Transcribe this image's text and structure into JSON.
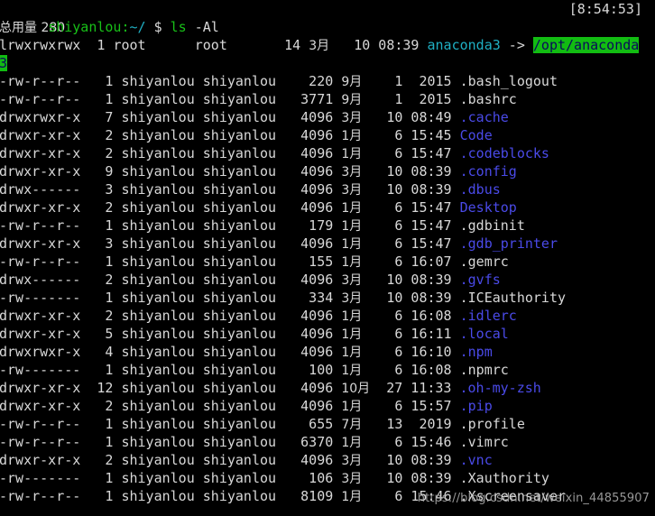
{
  "terminal": {
    "background_color": "#000000",
    "foreground_color": "#d8d8d8",
    "dir_color": "#4a4ae8",
    "symlink_color": "#1fb0c4",
    "prompt_color": "#18c018",
    "highlight_bg": "#12bc12"
  },
  "prompt": {
    "user_host": "shiyanlou:",
    "path": "~/",
    "sigil": "$",
    "command_name": "ls",
    "command_args": "-Al",
    "clock": "[8:54:53]"
  },
  "total_line": "总用量 280",
  "symlink_row": {
    "perms": "lrwxrwxrwx",
    "links": "1",
    "owner": "root",
    "group": "root",
    "size": "14",
    "month": "3月",
    "day": "10",
    "time": "08:39",
    "name": "anaconda3",
    "arrow": "->",
    "target_head": "/opt/anaconda",
    "target_wrap": "3"
  },
  "columns": [
    "perms",
    "links",
    "owner",
    "group",
    "size",
    "month",
    "day",
    "time",
    "name"
  ],
  "rows": [
    {
      "perms": "-rw-r--r--",
      "links": "1",
      "owner": "shiyanlou",
      "group": "shiyanlou",
      "size": "220",
      "month": "9月",
      "day": "1",
      "time": "2015",
      "name": ".bash_logout",
      "kind": "file"
    },
    {
      "perms": "-rw-r--r--",
      "links": "1",
      "owner": "shiyanlou",
      "group": "shiyanlou",
      "size": "3771",
      "month": "9月",
      "day": "1",
      "time": "2015",
      "name": ".bashrc",
      "kind": "file"
    },
    {
      "perms": "drwxrwxr-x",
      "links": "7",
      "owner": "shiyanlou",
      "group": "shiyanlou",
      "size": "4096",
      "month": "3月",
      "day": "10",
      "time": "08:49",
      "name": ".cache",
      "kind": "dir"
    },
    {
      "perms": "drwxr-xr-x",
      "links": "2",
      "owner": "shiyanlou",
      "group": "shiyanlou",
      "size": "4096",
      "month": "1月",
      "day": "6",
      "time": "15:45",
      "name": "Code",
      "kind": "dir"
    },
    {
      "perms": "drwxr-xr-x",
      "links": "2",
      "owner": "shiyanlou",
      "group": "shiyanlou",
      "size": "4096",
      "month": "1月",
      "day": "6",
      "time": "15:47",
      "name": ".codeblocks",
      "kind": "dir"
    },
    {
      "perms": "drwxr-xr-x",
      "links": "9",
      "owner": "shiyanlou",
      "group": "shiyanlou",
      "size": "4096",
      "month": "3月",
      "day": "10",
      "time": "08:39",
      "name": ".config",
      "kind": "dir"
    },
    {
      "perms": "drwx------",
      "links": "3",
      "owner": "shiyanlou",
      "group": "shiyanlou",
      "size": "4096",
      "month": "3月",
      "day": "10",
      "time": "08:39",
      "name": ".dbus",
      "kind": "dir"
    },
    {
      "perms": "drwxr-xr-x",
      "links": "2",
      "owner": "shiyanlou",
      "group": "shiyanlou",
      "size": "4096",
      "month": "1月",
      "day": "6",
      "time": "15:47",
      "name": "Desktop",
      "kind": "dir"
    },
    {
      "perms": "-rw-r--r--",
      "links": "1",
      "owner": "shiyanlou",
      "group": "shiyanlou",
      "size": "179",
      "month": "1月",
      "day": "6",
      "time": "15:47",
      "name": ".gdbinit",
      "kind": "file"
    },
    {
      "perms": "drwxr-xr-x",
      "links": "3",
      "owner": "shiyanlou",
      "group": "shiyanlou",
      "size": "4096",
      "month": "1月",
      "day": "6",
      "time": "15:47",
      "name": ".gdb_printer",
      "kind": "dir"
    },
    {
      "perms": "-rw-r--r--",
      "links": "1",
      "owner": "shiyanlou",
      "group": "shiyanlou",
      "size": "155",
      "month": "1月",
      "day": "6",
      "time": "16:07",
      "name": ".gemrc",
      "kind": "file"
    },
    {
      "perms": "drwx------",
      "links": "2",
      "owner": "shiyanlou",
      "group": "shiyanlou",
      "size": "4096",
      "month": "3月",
      "day": "10",
      "time": "08:39",
      "name": ".gvfs",
      "kind": "dir"
    },
    {
      "perms": "-rw-------",
      "links": "1",
      "owner": "shiyanlou",
      "group": "shiyanlou",
      "size": "334",
      "month": "3月",
      "day": "10",
      "time": "08:39",
      "name": ".ICEauthority",
      "kind": "file"
    },
    {
      "perms": "drwxr-xr-x",
      "links": "2",
      "owner": "shiyanlou",
      "group": "shiyanlou",
      "size": "4096",
      "month": "1月",
      "day": "6",
      "time": "16:08",
      "name": ".idlerc",
      "kind": "dir"
    },
    {
      "perms": "drwxr-xr-x",
      "links": "5",
      "owner": "shiyanlou",
      "group": "shiyanlou",
      "size": "4096",
      "month": "1月",
      "day": "6",
      "time": "16:11",
      "name": ".local",
      "kind": "dir"
    },
    {
      "perms": "drwxrwxr-x",
      "links": "4",
      "owner": "shiyanlou",
      "group": "shiyanlou",
      "size": "4096",
      "month": "1月",
      "day": "6",
      "time": "16:10",
      "name": ".npm",
      "kind": "dir"
    },
    {
      "perms": "-rw-------",
      "links": "1",
      "owner": "shiyanlou",
      "group": "shiyanlou",
      "size": "100",
      "month": "1月",
      "day": "6",
      "time": "16:08",
      "name": ".npmrc",
      "kind": "file"
    },
    {
      "perms": "drwxr-xr-x",
      "links": "12",
      "owner": "shiyanlou",
      "group": "shiyanlou",
      "size": "4096",
      "month": "10月",
      "day": "27",
      "time": "11:33",
      "name": ".oh-my-zsh",
      "kind": "dir"
    },
    {
      "perms": "drwxr-xr-x",
      "links": "2",
      "owner": "shiyanlou",
      "group": "shiyanlou",
      "size": "4096",
      "month": "1月",
      "day": "6",
      "time": "15:57",
      "name": ".pip",
      "kind": "dir"
    },
    {
      "perms": "-rw-r--r--",
      "links": "1",
      "owner": "shiyanlou",
      "group": "shiyanlou",
      "size": "655",
      "month": "7月",
      "day": "13",
      "time": "2019",
      "name": ".profile",
      "kind": "file"
    },
    {
      "perms": "-rw-r--r--",
      "links": "1",
      "owner": "shiyanlou",
      "group": "shiyanlou",
      "size": "6370",
      "month": "1月",
      "day": "6",
      "time": "15:46",
      "name": ".vimrc",
      "kind": "file"
    },
    {
      "perms": "drwxr-xr-x",
      "links": "2",
      "owner": "shiyanlou",
      "group": "shiyanlou",
      "size": "4096",
      "month": "3月",
      "day": "10",
      "time": "08:39",
      "name": ".vnc",
      "kind": "dir"
    },
    {
      "perms": "-rw-------",
      "links": "1",
      "owner": "shiyanlou",
      "group": "shiyanlou",
      "size": "106",
      "month": "3月",
      "day": "10",
      "time": "08:39",
      "name": ".Xauthority",
      "kind": "file"
    },
    {
      "perms": "-rw-r--r--",
      "links": "1",
      "owner": "shiyanlou",
      "group": "shiyanlou",
      "size": "8109",
      "month": "1月",
      "day": "6",
      "time": "15:46",
      "name": ".Xscreensaver",
      "kind": "file"
    }
  ],
  "watermark": "https://blog.csdn.net/weixin_44855907"
}
